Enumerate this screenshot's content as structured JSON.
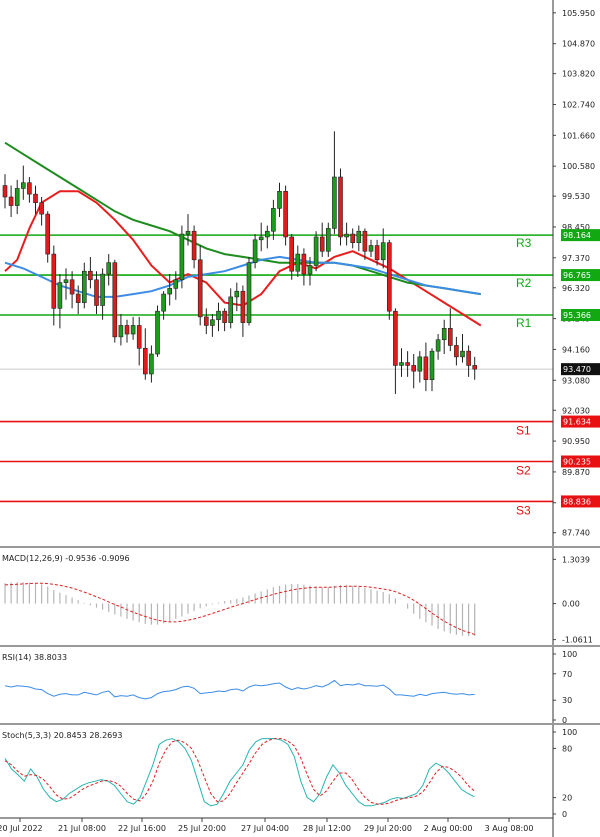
{
  "chart_data": [
    {
      "type": "candlestick",
      "price_axis": {
        "labels": [
          "105.950",
          "104.870",
          "103.820",
          "102.740",
          "101.660",
          "100.580",
          "99.530",
          "98.450",
          "97.370",
          "96.320",
          "95.240",
          "94.160",
          "93.080",
          "92.030",
          "90.950",
          "89.870",
          "88.790",
          "87.740"
        ],
        "range": [
          87.24,
          106.4
        ]
      },
      "time_axis": {
        "labels": [
          "20 Jul 2022",
          "21 Jul 08:00",
          "22 Jul 16:00",
          "25 Jul 20:00",
          "27 Jul 04:00",
          "28 Jul 12:00",
          "29 Jul 20:00",
          "2 Aug 00:00",
          "3 Aug 08:00"
        ]
      },
      "last_price": {
        "value": 93.47,
        "label": "93.470"
      },
      "levels": [
        {
          "name": "R3",
          "value": 98.164,
          "label": "98.164",
          "color": "#11a811"
        },
        {
          "name": "R2",
          "value": 96.765,
          "label": "96.765",
          "color": "#11a811"
        },
        {
          "name": "R1",
          "value": 95.366,
          "label": "95.366",
          "color": "#11a811"
        },
        {
          "name": "S1",
          "value": 91.634,
          "label": "91.634",
          "color": "#e81010"
        },
        {
          "name": "S2",
          "value": 90.235,
          "label": "90.235",
          "color": "#e81010"
        },
        {
          "name": "S3",
          "value": 88.836,
          "label": "88.836",
          "color": "#e81010"
        }
      ],
      "candles": [
        [
          99.9,
          100.3,
          99.1,
          99.5
        ],
        [
          99.5,
          99.9,
          98.8,
          99.2
        ],
        [
          99.2,
          100.1,
          98.9,
          99.8
        ],
        [
          99.8,
          100.6,
          99.4,
          100.0
        ],
        [
          100.0,
          100.2,
          99.3,
          99.6
        ],
        [
          99.6,
          99.9,
          98.9,
          99.3
        ],
        [
          99.3,
          99.5,
          98.5,
          98.9
        ],
        [
          98.9,
          99.0,
          97.2,
          97.5
        ],
        [
          97.5,
          97.8,
          95.0,
          95.6
        ],
        [
          95.6,
          96.8,
          94.9,
          96.5
        ],
        [
          96.5,
          97.0,
          95.9,
          96.6
        ],
        [
          96.6,
          96.9,
          95.6,
          96.1
        ],
        [
          96.1,
          96.4,
          95.4,
          95.8
        ],
        [
          95.8,
          97.2,
          95.6,
          96.9
        ],
        [
          96.9,
          97.4,
          96.3,
          96.6
        ],
        [
          96.6,
          96.9,
          95.4,
          95.7
        ],
        [
          95.7,
          97.0,
          95.2,
          96.8
        ],
        [
          96.8,
          97.5,
          96.4,
          97.2
        ],
        [
          97.2,
          97.3,
          94.4,
          94.6
        ],
        [
          94.6,
          95.4,
          94.3,
          95.0
        ],
        [
          95.0,
          95.2,
          94.4,
          94.7
        ],
        [
          94.7,
          95.3,
          94.5,
          95.0
        ],
        [
          95.0,
          95.3,
          93.6,
          94.2
        ],
        [
          94.2,
          94.9,
          93.1,
          93.3
        ],
        [
          93.3,
          94.3,
          93.0,
          94.0
        ],
        [
          94.0,
          95.7,
          93.9,
          95.5
        ],
        [
          95.5,
          96.2,
          95.2,
          96.1
        ],
        [
          96.1,
          96.8,
          95.7,
          96.3
        ],
        [
          96.3,
          96.9,
          95.9,
          96.6
        ],
        [
          96.6,
          98.5,
          96.3,
          98.2
        ],
        [
          98.2,
          98.9,
          97.8,
          98.3
        ],
        [
          98.3,
          98.5,
          97.0,
          97.3
        ],
        [
          97.3,
          97.8,
          95.0,
          95.3
        ],
        [
          95.3,
          95.6,
          94.7,
          95.0
        ],
        [
          95.0,
          95.4,
          94.6,
          95.2
        ],
        [
          95.2,
          95.8,
          94.8,
          95.5
        ],
        [
          95.5,
          95.6,
          94.8,
          95.1
        ],
        [
          95.1,
          96.3,
          94.9,
          96.0
        ],
        [
          96.0,
          96.5,
          95.5,
          96.2
        ],
        [
          96.2,
          96.4,
          94.6,
          95.1
        ],
        [
          95.1,
          97.4,
          95.0,
          97.2
        ],
        [
          97.2,
          98.2,
          97.0,
          98.0
        ],
        [
          98.0,
          98.6,
          97.6,
          98.1
        ],
        [
          98.1,
          98.5,
          97.7,
          98.3
        ],
        [
          98.3,
          99.4,
          98.0,
          99.1
        ],
        [
          99.1,
          100.0,
          98.8,
          99.7
        ],
        [
          99.7,
          99.9,
          97.8,
          98.1
        ],
        [
          98.1,
          98.2,
          96.6,
          96.9
        ],
        [
          96.9,
          97.8,
          96.7,
          97.5
        ],
        [
          97.5,
          97.7,
          96.4,
          96.8
        ],
        [
          96.8,
          97.4,
          96.4,
          97.1
        ],
        [
          97.1,
          98.3,
          96.9,
          98.1
        ],
        [
          98.1,
          98.6,
          97.4,
          97.6
        ],
        [
          97.6,
          98.6,
          97.4,
          98.4
        ],
        [
          98.4,
          101.8,
          98.2,
          100.2
        ],
        [
          100.2,
          100.5,
          97.8,
          98.1
        ],
        [
          98.1,
          98.6,
          97.8,
          98.2
        ],
        [
          98.2,
          98.4,
          97.7,
          97.9
        ],
        [
          97.9,
          98.5,
          97.6,
          98.3
        ],
        [
          98.3,
          98.4,
          97.3,
          97.6
        ],
        [
          97.6,
          98.0,
          97.4,
          97.8
        ],
        [
          97.8,
          98.0,
          97.1,
          97.3
        ],
        [
          97.3,
          98.4,
          97.0,
          97.9
        ],
        [
          97.9,
          98.0,
          95.2,
          95.5
        ],
        [
          95.5,
          95.6,
          92.6,
          93.6
        ],
        [
          93.6,
          94.2,
          93.2,
          93.7
        ],
        [
          93.7,
          94.1,
          93.2,
          93.6
        ],
        [
          93.6,
          94.0,
          92.8,
          93.4
        ],
        [
          93.4,
          94.1,
          93.0,
          93.9
        ],
        [
          93.9,
          94.4,
          92.7,
          93.1
        ],
        [
          93.1,
          94.2,
          92.7,
          94.1
        ],
        [
          94.1,
          94.7,
          93.8,
          94.5
        ],
        [
          94.5,
          95.2,
          94.0,
          94.9
        ],
        [
          94.9,
          95.6,
          94.1,
          94.3
        ],
        [
          94.3,
          94.6,
          93.6,
          93.9
        ],
        [
          93.9,
          94.7,
          93.7,
          94.1
        ],
        [
          94.1,
          94.3,
          93.2,
          93.6
        ],
        [
          93.6,
          93.9,
          93.1,
          93.47
        ]
      ],
      "moving_averages": [
        {
          "color": "#e81e1e",
          "values": [
            [
              0,
              96.9
            ],
            [
              2,
              97.3
            ],
            [
              4,
              98.4
            ],
            [
              6,
              99.3
            ],
            [
              9,
              99.7
            ],
            [
              12,
              99.7
            ],
            [
              15,
              99.3
            ],
            [
              18,
              98.7
            ],
            [
              21,
              98.0
            ],
            [
              24,
              97.1
            ],
            [
              27,
              96.5
            ],
            [
              30,
              96.8
            ],
            [
              33,
              96.5
            ],
            [
              36,
              95.8
            ],
            [
              39,
              95.7
            ],
            [
              42,
              96.1
            ],
            [
              45,
              96.9
            ],
            [
              48,
              97.2
            ],
            [
              51,
              97.0
            ],
            [
              54,
              97.4
            ],
            [
              57,
              97.6
            ],
            [
              60,
              97.3
            ],
            [
              63,
              97.0
            ],
            [
              66,
              96.6
            ],
            [
              69,
              96.2
            ],
            [
              72,
              95.8
            ],
            [
              75,
              95.4
            ],
            [
              78,
              95.0
            ]
          ]
        },
        {
          "color": "#1e8c1e",
          "values": [
            [
              0,
              101.4
            ],
            [
              3,
              101.0
            ],
            [
              6,
              100.6
            ],
            [
              9,
              100.2
            ],
            [
              12,
              99.8
            ],
            [
              15,
              99.4
            ],
            [
              18,
              99.0
            ],
            [
              21,
              98.7
            ],
            [
              24,
              98.5
            ],
            [
              27,
              98.3
            ],
            [
              30,
              98.0
            ],
            [
              33,
              97.7
            ],
            [
              36,
              97.5
            ],
            [
              39,
              97.4
            ],
            [
              42,
              97.3
            ],
            [
              45,
              97.2
            ],
            [
              48,
              97.2
            ],
            [
              51,
              97.2
            ],
            [
              54,
              97.2
            ],
            [
              57,
              97.1
            ],
            [
              60,
              96.9
            ],
            [
              63,
              96.7
            ],
            [
              66,
              96.5
            ],
            [
              69,
              96.4
            ],
            [
              72,
              96.3
            ],
            [
              75,
              96.2
            ],
            [
              78,
              96.1
            ]
          ]
        },
        {
          "color": "#3c8ce6",
          "values": [
            [
              0,
              97.2
            ],
            [
              3,
              97.0
            ],
            [
              6,
              96.7
            ],
            [
              9,
              96.4
            ],
            [
              12,
              96.2
            ],
            [
              15,
              96.0
            ],
            [
              18,
              96.0
            ],
            [
              21,
              96.1
            ],
            [
              24,
              96.2
            ],
            [
              27,
              96.4
            ],
            [
              30,
              96.7
            ],
            [
              33,
              96.8
            ],
            [
              36,
              96.9
            ],
            [
              39,
              97.1
            ],
            [
              42,
              97.3
            ],
            [
              45,
              97.4
            ],
            [
              48,
              97.3
            ],
            [
              51,
              97.2
            ],
            [
              54,
              97.2
            ],
            [
              57,
              97.1
            ],
            [
              60,
              97.0
            ],
            [
              63,
              96.8
            ],
            [
              66,
              96.6
            ],
            [
              69,
              96.4
            ],
            [
              72,
              96.3
            ],
            [
              75,
              96.2
            ],
            [
              78,
              96.1
            ]
          ]
        }
      ]
    },
    {
      "type": "histogram",
      "title": "MACD(12,26,9) -0.9536 -0.9096",
      "axis_labels": [
        "1.3039",
        "0.00",
        "-1.0611"
      ],
      "range": [
        -1.25,
        1.55
      ],
      "histogram": [
        0.6,
        0.62,
        0.63,
        0.63,
        0.62,
        0.6,
        0.57,
        0.5,
        0.4,
        0.32,
        0.25,
        0.18,
        0.1,
        0.02,
        -0.05,
        -0.12,
        -0.18,
        -0.25,
        -0.32,
        -0.38,
        -0.45,
        -0.5,
        -0.55,
        -0.6,
        -0.62,
        -0.62,
        -0.58,
        -0.52,
        -0.45,
        -0.38,
        -0.3,
        -0.22,
        -0.14,
        -0.08,
        -0.02,
        0.03,
        0.07,
        0.1,
        0.14,
        0.18,
        0.24,
        0.3,
        0.36,
        0.42,
        0.48,
        0.52,
        0.56,
        0.58,
        0.58,
        0.56,
        0.53,
        0.5,
        0.48,
        0.48,
        0.52,
        0.55,
        0.55,
        0.53,
        0.5,
        0.46,
        0.42,
        0.38,
        0.34,
        0.28,
        0.15,
        0.0,
        -0.15,
        -0.3,
        -0.45,
        -0.55,
        -0.65,
        -0.75,
        -0.82,
        -0.88,
        -0.92,
        -0.95,
        -0.96,
        -0.95
      ],
      "signal": [
        0.55,
        0.56,
        0.57,
        0.58,
        0.59,
        0.6,
        0.6,
        0.59,
        0.57,
        0.54,
        0.5,
        0.46,
        0.4,
        0.34,
        0.27,
        0.2,
        0.13,
        0.05,
        -0.03,
        -0.1,
        -0.18,
        -0.25,
        -0.32,
        -0.38,
        -0.44,
        -0.49,
        -0.52,
        -0.54,
        -0.54,
        -0.52,
        -0.49,
        -0.45,
        -0.4,
        -0.35,
        -0.29,
        -0.23,
        -0.17,
        -0.11,
        -0.05,
        0.0,
        0.06,
        0.12,
        0.17,
        0.22,
        0.27,
        0.32,
        0.36,
        0.4,
        0.43,
        0.45,
        0.47,
        0.48,
        0.48,
        0.48,
        0.49,
        0.5,
        0.51,
        0.51,
        0.51,
        0.5,
        0.48,
        0.46,
        0.43,
        0.4,
        0.35,
        0.28,
        0.2,
        0.1,
        -0.02,
        -0.15,
        -0.28,
        -0.4,
        -0.52,
        -0.62,
        -0.71,
        -0.79,
        -0.85,
        -0.91
      ]
    },
    {
      "type": "line",
      "title": "RSI(14) 38.8033",
      "axis_labels": [
        "100",
        "70",
        "30",
        "0"
      ],
      "range": [
        0,
        100
      ],
      "values": [
        52,
        50,
        52,
        51,
        50,
        47,
        46,
        40,
        36,
        39,
        40,
        38,
        38,
        42,
        40,
        38,
        42,
        44,
        35,
        37,
        36,
        38,
        34,
        32,
        34,
        40,
        43,
        44,
        46,
        50,
        51,
        48,
        40,
        41,
        42,
        44,
        43,
        46,
        47,
        44,
        50,
        53,
        52,
        53,
        55,
        56,
        50,
        46,
        49,
        47,
        49,
        52,
        50,
        54,
        60,
        52,
        54,
        53,
        55,
        52,
        52,
        51,
        53,
        47,
        38,
        38,
        37,
        36,
        39,
        37,
        40,
        41,
        42,
        40,
        39,
        40,
        38,
        38.8
      ]
    },
    {
      "type": "line",
      "title": "Stoch(5,3,3) 20.8453 28.2693",
      "axis_labels": [
        "100",
        "80",
        "20",
        "0"
      ],
      "range": [
        0,
        100
      ],
      "k": [
        68,
        55,
        48,
        40,
        55,
        45,
        30,
        20,
        15,
        18,
        25,
        30,
        35,
        38,
        40,
        42,
        40,
        35,
        25,
        15,
        12,
        20,
        40,
        60,
        85,
        90,
        92,
        88,
        80,
        65,
        40,
        15,
        10,
        12,
        25,
        40,
        50,
        60,
        78,
        88,
        92,
        92,
        92,
        90,
        85,
        70,
        40,
        20,
        15,
        25,
        45,
        60,
        50,
        35,
        25,
        15,
        10,
        10,
        12,
        14,
        18,
        20,
        19,
        22,
        25,
        35,
        55,
        62,
        58,
        50,
        40,
        30,
        25,
        21
      ],
      "d": [
        65,
        60,
        52,
        46,
        48,
        47,
        42,
        33,
        23,
        18,
        19,
        24,
        30,
        34,
        37,
        40,
        41,
        39,
        34,
        25,
        18,
        16,
        25,
        40,
        62,
        78,
        88,
        90,
        87,
        80,
        65,
        45,
        25,
        15,
        16,
        25,
        38,
        50,
        62,
        75,
        85,
        90,
        92,
        92,
        89,
        83,
        68,
        48,
        30,
        22,
        28,
        40,
        50,
        50,
        42,
        30,
        20,
        14,
        12,
        12,
        14,
        17,
        19,
        20,
        22,
        27,
        38,
        50,
        58,
        57,
        52,
        45,
        35,
        28
      ]
    }
  ]
}
